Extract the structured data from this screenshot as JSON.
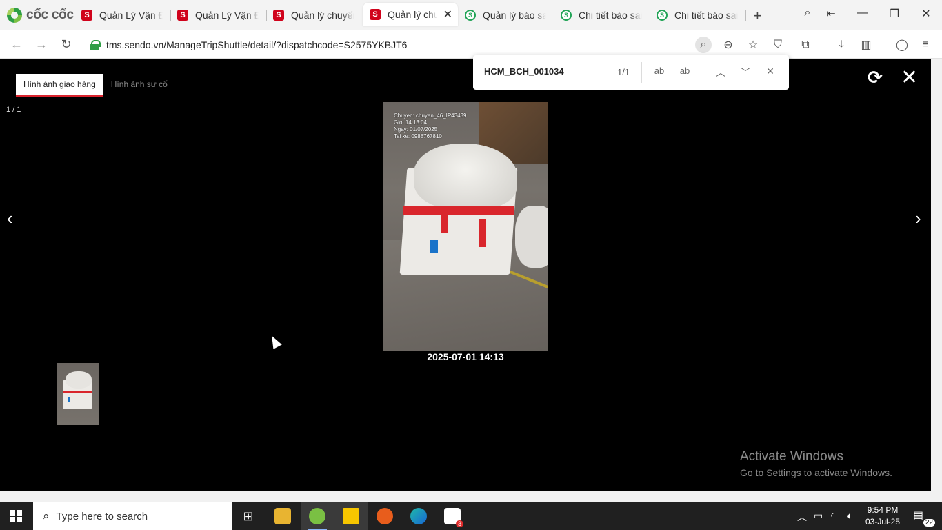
{
  "browser": {
    "brand": "cốc cốc",
    "tabs": [
      {
        "label": "Quản Lý Vận Đơn",
        "favicon": "sendo-red"
      },
      {
        "label": "Quản Lý Vận Đơn",
        "favicon": "sendo-red"
      },
      {
        "label": "Quản lý chuyến xe",
        "favicon": "sendo-red"
      },
      {
        "label": "Quản lý chuyến",
        "favicon": "sendo-red",
        "active": true
      },
      {
        "label": "Quản lý báo sai",
        "favicon": "green-s"
      },
      {
        "label": "Chi tiết báo sai",
        "favicon": "green-s"
      },
      {
        "label": "Chi tiết báo sai",
        "favicon": "green-s"
      }
    ],
    "url": "tms.sendo.vn/ManageTripShuttle/detail/?dispatchcode=S2575YKBJT6"
  },
  "find": {
    "query": "HCM_BCH_001034",
    "count": "1/1",
    "match_case_label": "ab",
    "whole_word_label": "ab"
  },
  "viewer": {
    "tabs": [
      {
        "label": "Hình ảnh giao hàng",
        "active": true
      },
      {
        "label": "Hình ảnh sự cố",
        "active": false
      }
    ],
    "counter": "1 / 1",
    "photo_stamp": [
      "Chuyen: chuyen_46_IP43439",
      "Gio: 14:13:04",
      "Ngay: 01/07/2025",
      "Tai xe: 0988767810"
    ],
    "caption": "2025-07-01 14:13"
  },
  "watermark": {
    "line1": "Activate Windows",
    "line2": "Go to Settings to activate Windows."
  },
  "taskbar": {
    "search_placeholder": "Type here to search",
    "time": "9:54 PM",
    "date": "03-Jul-25",
    "notifications": "22",
    "zalo_badge": "3"
  },
  "colors": {
    "accent_red": "#d9232d",
    "brand_green": "#2e9e45"
  }
}
